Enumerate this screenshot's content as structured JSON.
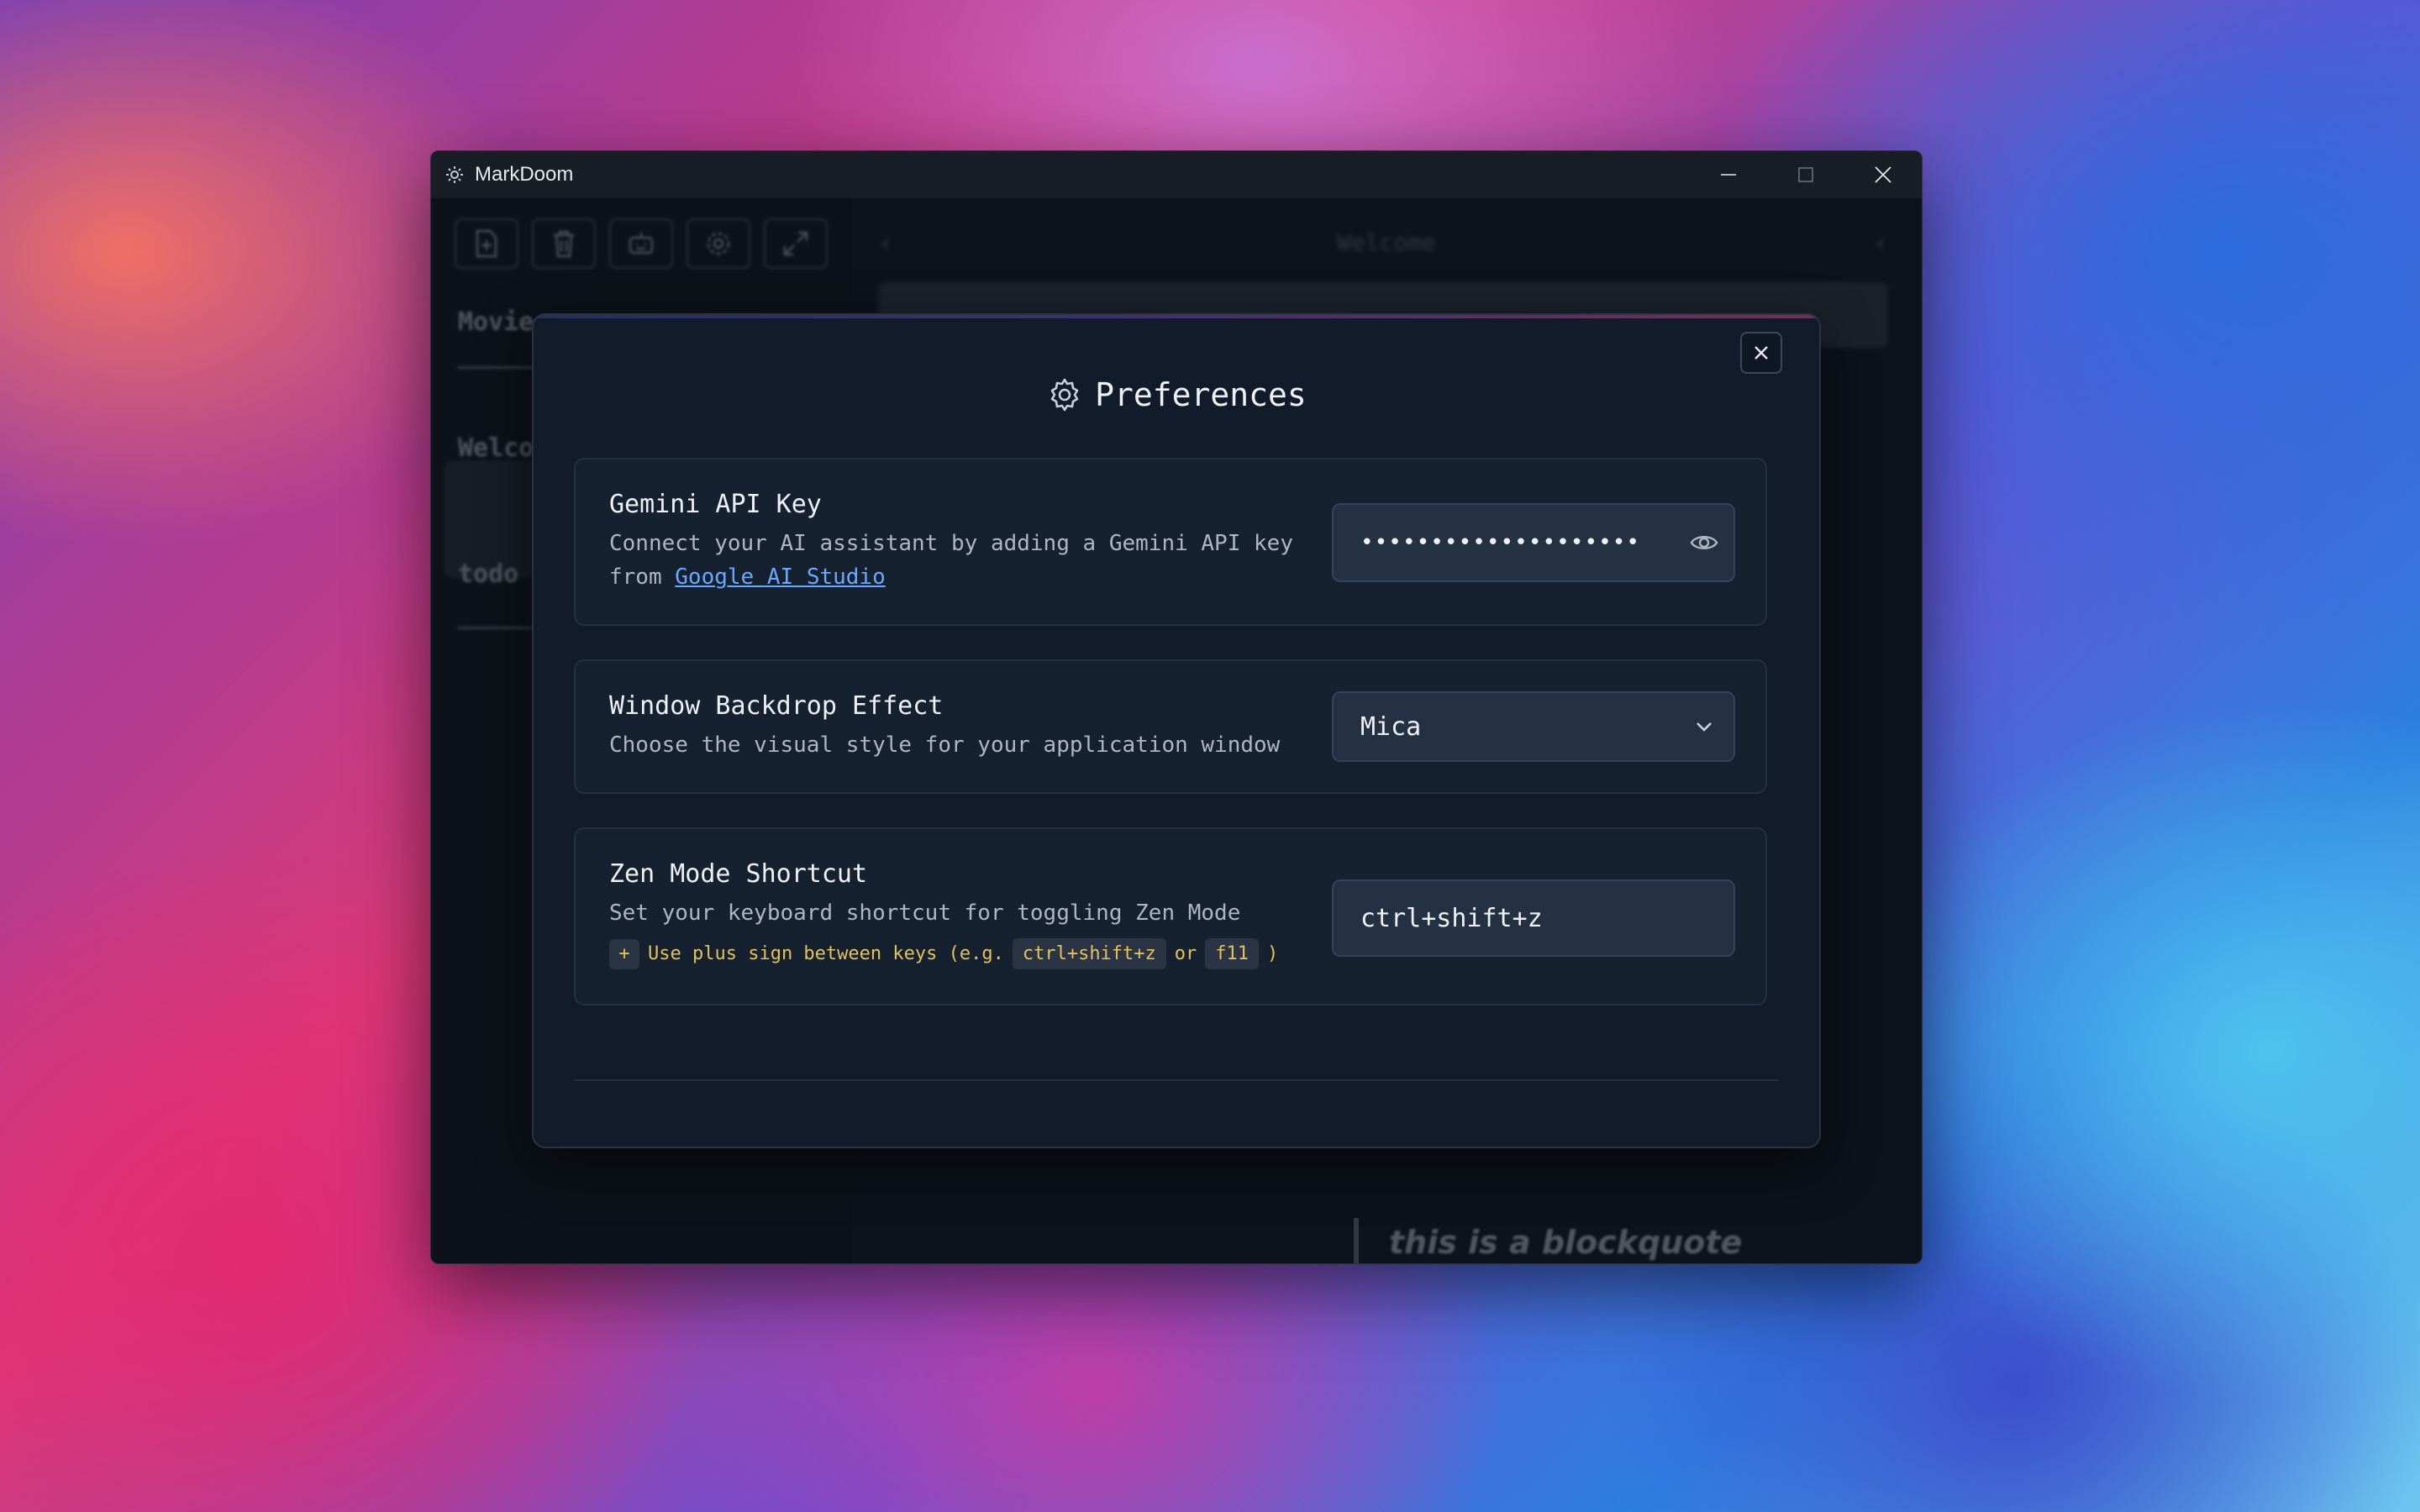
{
  "app": {
    "title": "MarkDoom"
  },
  "sidebar": {
    "notes": [
      {
        "title": "Movie"
      },
      {
        "title": "Welco"
      },
      {
        "title": "todo"
      }
    ]
  },
  "editor": {
    "note_title": "Welcome",
    "blockquote": "this is a blockquote"
  },
  "preferences": {
    "title": "Preferences",
    "gemini": {
      "label": "Gemini API Key",
      "description": "Connect your AI assistant by adding a Gemini API key from",
      "link_text": "Google AI Studio",
      "value": "••••••••••••••••••••"
    },
    "backdrop": {
      "label": "Window Backdrop Effect",
      "description": "Choose the visual style for your application window",
      "selected": "Mica"
    },
    "zen": {
      "label": "Zen Mode Shortcut",
      "description": "Set your keyboard shortcut for toggling Zen Mode",
      "value": "ctrl+shift+z",
      "hint_plus": "+",
      "hint_prefix": "Use plus sign between keys (e.g.",
      "hint_example_1": "ctrl+shift+z",
      "hint_or": "or",
      "hint_example_2": "f11",
      "hint_suffix": ")"
    }
  },
  "icons": {
    "app": "gear-app-icon",
    "minimize": "minimize-icon",
    "maximize": "maximize-icon",
    "close": "close-icon",
    "new_note": "new-file-icon",
    "delete": "trash-icon",
    "ai": "robot-icon",
    "settings": "gear-icon",
    "zen": "expand-icon",
    "reveal": "eye-icon",
    "dropdown": "chevron-down-icon"
  },
  "colors": {
    "accent_link": "#6aa8ff",
    "hint": "#e3c25a",
    "modal_bg": "#121b29"
  }
}
